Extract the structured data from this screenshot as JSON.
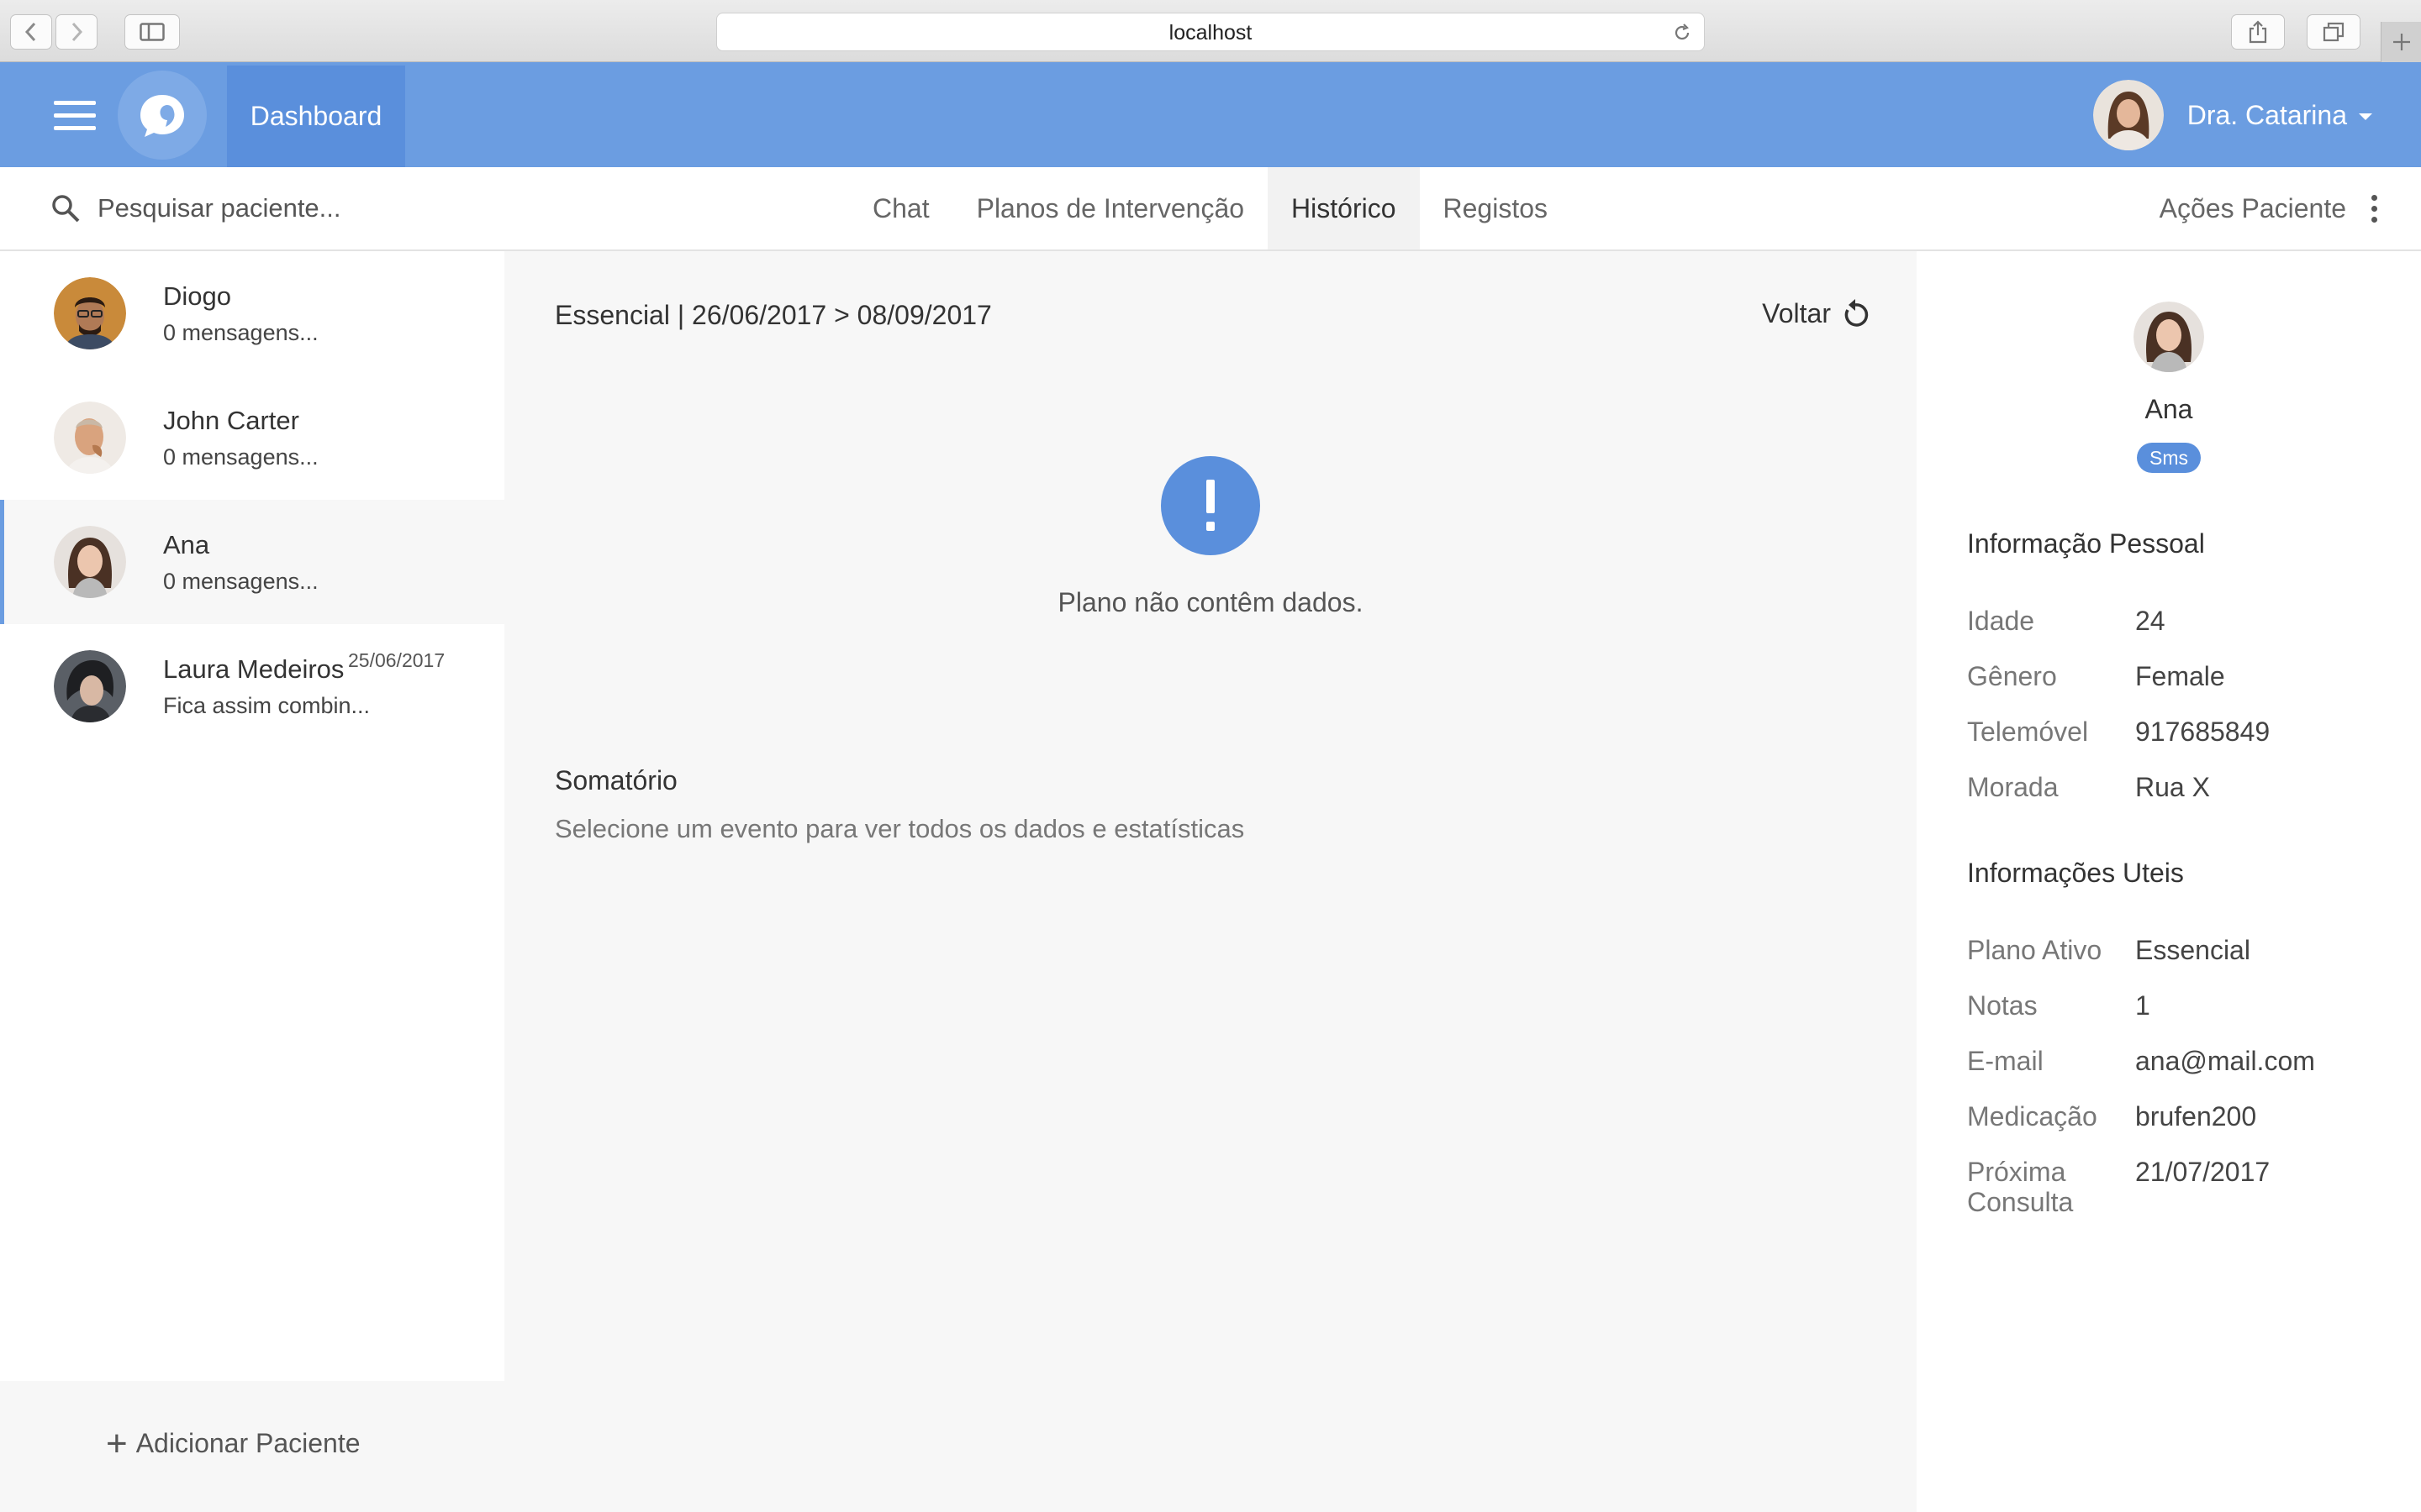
{
  "browser": {
    "url": "localhost"
  },
  "header": {
    "dashboard_label": "Dashboard",
    "user_name": "Dra. Catarina"
  },
  "subnav": {
    "search_placeholder": "Pesquisar paciente...",
    "tabs": [
      {
        "label": "Chat",
        "active": false
      },
      {
        "label": "Planos de Intervenção",
        "active": false
      },
      {
        "label": "Histórico",
        "active": true
      },
      {
        "label": "Registos",
        "active": false
      }
    ],
    "actions_label": "Ações Paciente"
  },
  "sidebar": {
    "patients": [
      {
        "name": "Diogo",
        "message": "0 mensagens...",
        "date": ""
      },
      {
        "name": "John Carter",
        "message": "0 mensagens...",
        "date": ""
      },
      {
        "name": "Ana",
        "message": "0 mensagens...",
        "date": "",
        "selected": true
      },
      {
        "name": "Laura Medeiros",
        "message": "Fica assim combin...",
        "date": "25/06/2017"
      }
    ],
    "add_label": "Adicionar Paciente"
  },
  "main": {
    "period": "Essencial | 26/06/2017 > 08/09/2017",
    "back_label": "Voltar",
    "empty_message": "Plano não contêm dados.",
    "summary_title": "Somatório",
    "summary_hint": "Selecione um evento para ver todos os dados e estatísticas"
  },
  "profile": {
    "name": "Ana",
    "badge": "Sms",
    "personal_title": "Informação Pessoal",
    "personal": [
      {
        "label": "Idade",
        "value": "24"
      },
      {
        "label": "Gênero",
        "value": "Female"
      },
      {
        "label": "Telemóvel",
        "value": "917685849"
      },
      {
        "label": "Morada",
        "value": "Rua X"
      }
    ],
    "useful_title": "Informações Uteis",
    "useful": [
      {
        "label": "Plano Ativo",
        "value": "Essencial"
      },
      {
        "label": "Notas",
        "value": "1"
      },
      {
        "label": "E-mail",
        "value": "ana@mail.com"
      },
      {
        "label": "Medicação",
        "value": "brufen200"
      },
      {
        "label": "Próxima Consulta",
        "value": "21/07/2017"
      }
    ]
  },
  "colors": {
    "primary": "#6b9de1",
    "primary_dark": "#5a8fdc"
  }
}
